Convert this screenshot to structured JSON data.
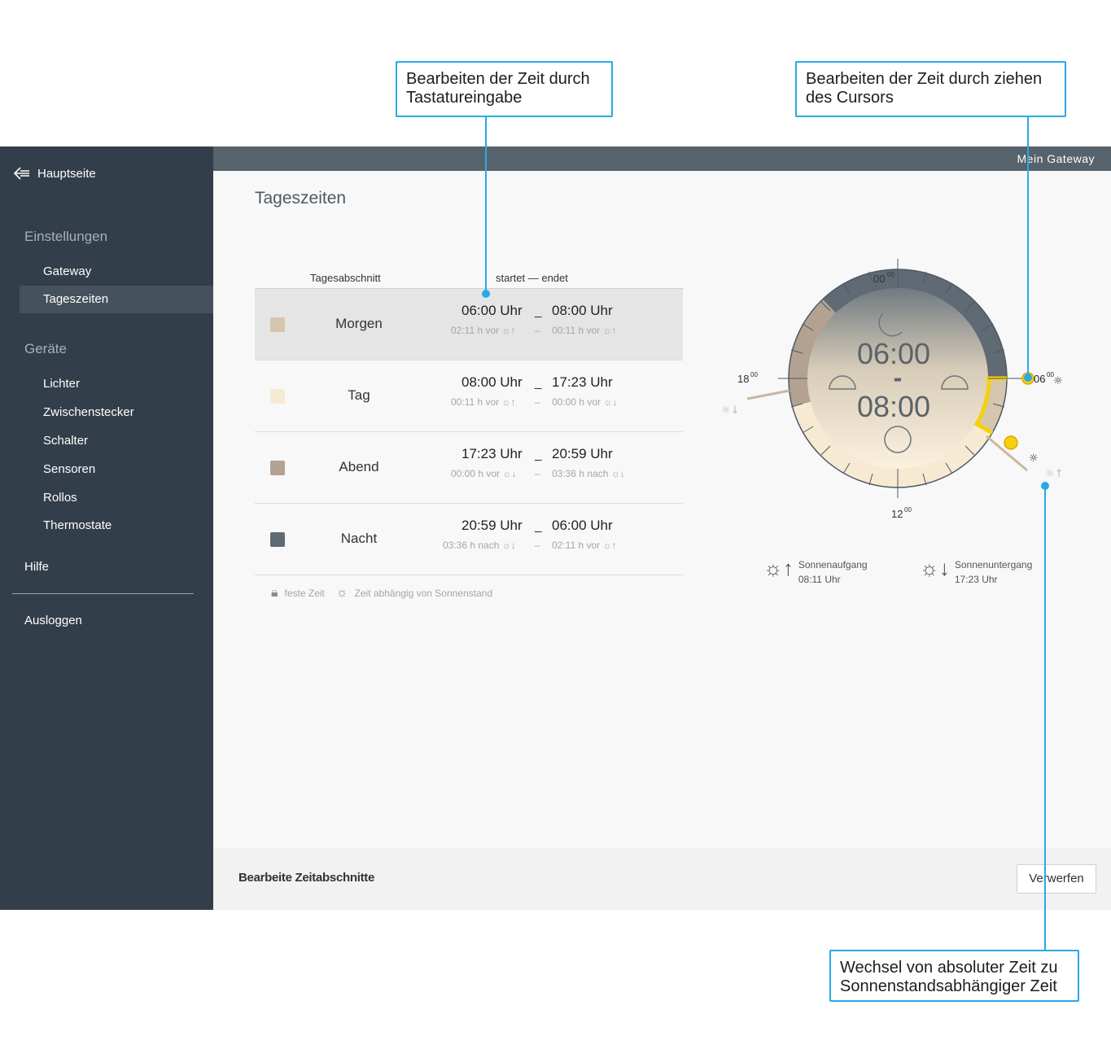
{
  "callouts": {
    "keyboard": [
      "Bearbeiten der Zeit durch",
      "Tastatureingabe"
    ],
    "cursor": [
      "Bearbeiten der Zeit durch ziehen",
      "des Cursors"
    ],
    "switch": [
      "Wechsel von absoluter Zeit zu",
      "Sonnenstandsabhängiger Zeit"
    ]
  },
  "sidebar": {
    "back_label": "Hauptseite",
    "section_settings": "Einstellungen",
    "settings_items": [
      "Gateway",
      "Tageszeiten"
    ],
    "section_devices": "Geräte",
    "device_items": [
      "Lichter",
      "Zwischenstecker",
      "Schalter",
      "Sensoren",
      "Rollos",
      "Thermostate"
    ],
    "help": "Hilfe",
    "logout": "Ausloggen"
  },
  "topbar": {
    "gateway_name": "Mein Gateway"
  },
  "page": {
    "title": "Tageszeiten"
  },
  "table": {
    "col_section": "Tagesabschnitt",
    "col_times": "startet — endet",
    "rows": [
      {
        "name": "Morgen",
        "color": "#d6c6ad",
        "start": "06:00 Uhr",
        "end": "08:00 Uhr",
        "start_rel": "02:11 h vor ☼↑",
        "end_rel": "00:11 h vor ☼↑"
      },
      {
        "name": "Tag",
        "color": "#f7ead3",
        "start": "08:00 Uhr",
        "end": "17:23 Uhr",
        "start_rel": "00:11 h vor ☼↑",
        "end_rel": "00:00 h vor ☼↓"
      },
      {
        "name": "Abend",
        "color": "#b3a291",
        "start": "17:23 Uhr",
        "end": "20:59 Uhr",
        "start_rel": "00:00 h vor ☼↓",
        "end_rel": "03:36 h nach ☼↓"
      },
      {
        "name": "Nacht",
        "color": "#5f6a74",
        "start": "20:59 Uhr",
        "end": "06:00 Uhr",
        "start_rel": "03:36 h nach ☼↓",
        "end_rel": "02:11 h vor ☼↑"
      }
    ],
    "time_sep": "_",
    "rel_sep": "–",
    "legend_fixed": "feste Zeit",
    "legend_sun": "Zeit abhängig von Sonnenstand"
  },
  "clock": {
    "label_top": "00",
    "label_left": "18",
    "label_bottom": "12",
    "label_right": "06",
    "sup": "00",
    "center_start": "06:00",
    "center_dash": "-",
    "center_end": "08:00"
  },
  "sun": {
    "rise_label": "Sonnenaufgang",
    "rise_time": "08:11 Uhr",
    "set_label": "Sonnenuntergang",
    "set_time": "17:23 Uhr"
  },
  "footer": {
    "title": "Bearbeite Zeitabschnitte",
    "discard": "Verwerfen"
  },
  "colors": {
    "accent": "#29a9e6",
    "highlight": "#f5d10a",
    "sidebar": "#323e49"
  }
}
